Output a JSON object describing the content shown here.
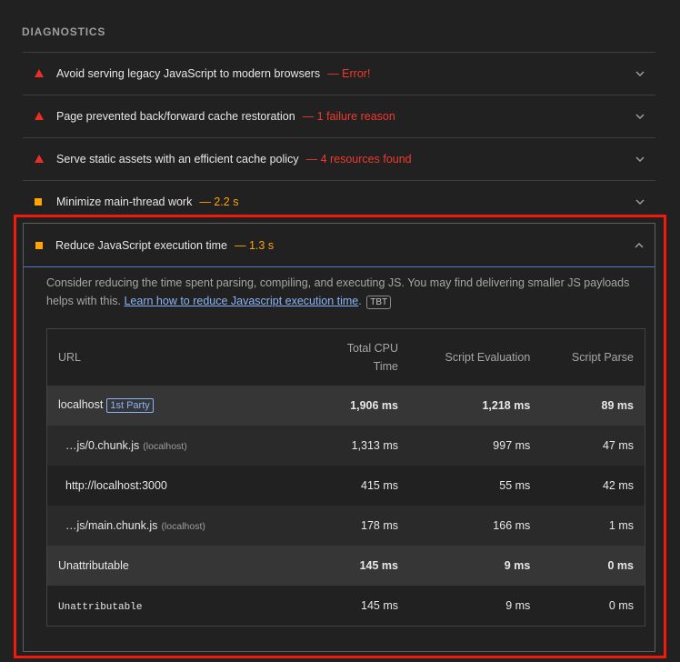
{
  "section": {
    "title": "DIAGNOSTICS"
  },
  "audits": [
    {
      "title": "Avoid serving legacy JavaScript to modern browsers",
      "sep": "—",
      "value": "Error!",
      "level": "fail"
    },
    {
      "title": "Page prevented back/forward cache restoration",
      "sep": "—",
      "value": "1 failure reason",
      "level": "fail"
    },
    {
      "title": "Serve static assets with an efficient cache policy",
      "sep": "—",
      "value": "4 resources found",
      "level": "fail"
    },
    {
      "title": "Minimize main-thread work",
      "sep": "—",
      "value": "2.2 s",
      "level": "average"
    }
  ],
  "expanded": {
    "title": "Reduce JavaScript execution time",
    "sep": "—",
    "value": "1.3 s",
    "description": "Consider reducing the time spent parsing, compiling, and executing JS. You may find delivering smaller JS payloads helps with this.",
    "link": "Learn how to reduce Javascript execution time",
    "period": ".",
    "badge": "TBT",
    "table": {
      "headers": {
        "url": "URL",
        "cpu": "Total CPU Time",
        "eval": "Script Evaluation",
        "parse": "Script Parse"
      },
      "rows": [
        {
          "url": "localhost",
          "badge": "1st Party",
          "cpu": "1,906 ms",
          "eval": "1,218 ms",
          "parse": "89 ms"
        },
        {
          "url": "…js/0.chunk.js",
          "host": "(localhost)",
          "cpu": "1,313 ms",
          "eval": "997 ms",
          "parse": "47 ms"
        },
        {
          "url": "http://localhost:3000",
          "cpu": "415 ms",
          "eval": "55 ms",
          "parse": "42 ms"
        },
        {
          "url": "…js/main.chunk.js",
          "host": "(localhost)",
          "cpu": "178 ms",
          "eval": "166 ms",
          "parse": "1 ms"
        },
        {
          "url": "Unattributable",
          "cpu": "145 ms",
          "eval": "9 ms",
          "parse": "0 ms"
        },
        {
          "url": "Unattributable",
          "cpu": "145 ms",
          "eval": "9 ms",
          "parse": "0 ms"
        }
      ]
    }
  },
  "colors": {
    "fail": "#eb2f25",
    "average": "#ffa400",
    "link": "#8ab4f8",
    "highlight": "#f31a0c"
  }
}
